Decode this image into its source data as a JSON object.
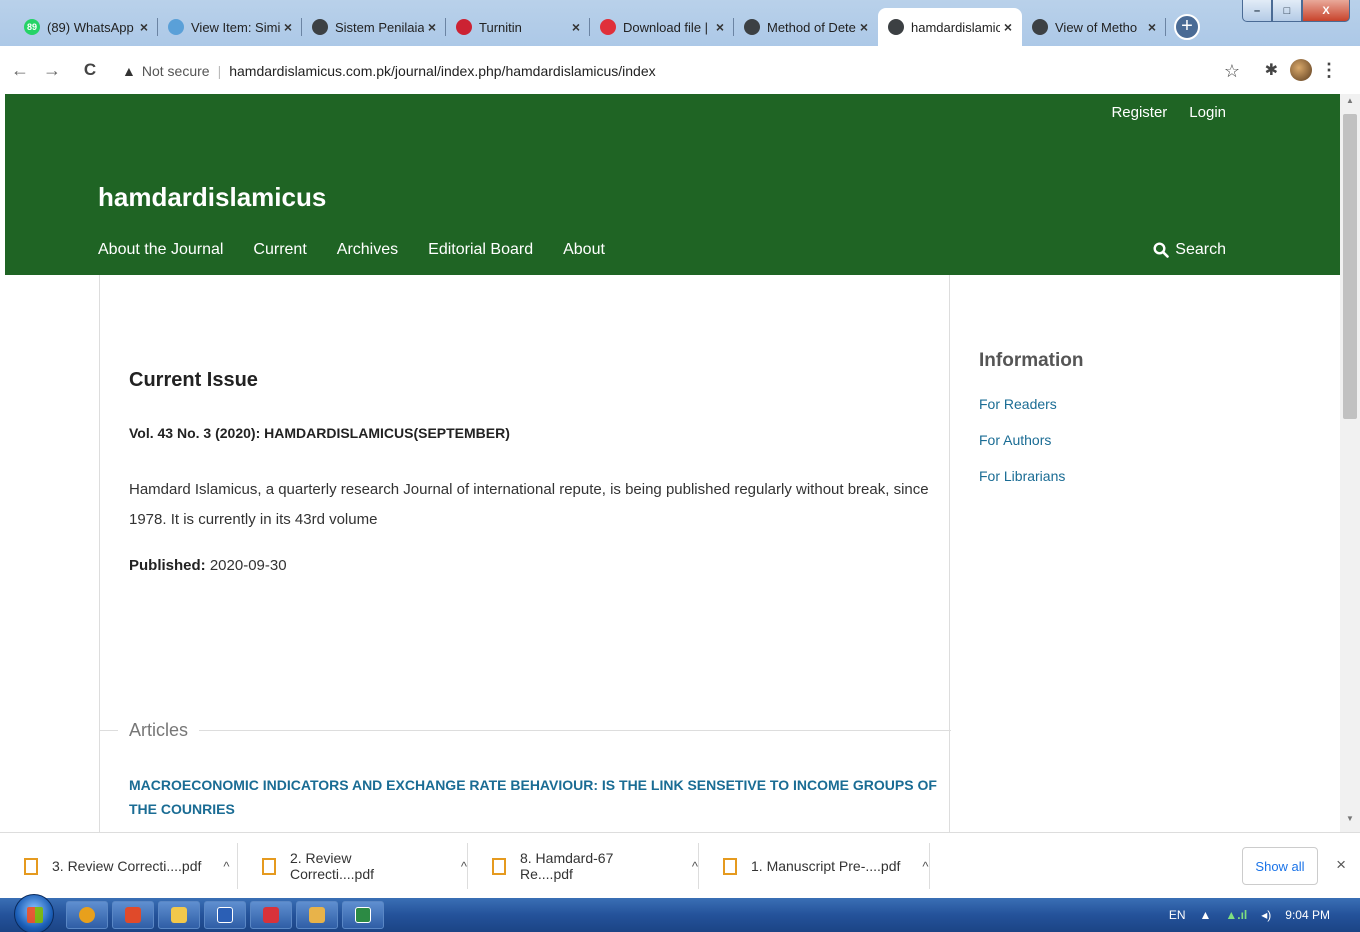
{
  "browser": {
    "tabs": [
      {
        "title": "(89) WhatsApp",
        "icon": "whatsapp-icon",
        "fav": "#25d366",
        "favtext": "89",
        "active": false
      },
      {
        "title": "View Item: Simi",
        "icon": "repository-icon",
        "fav": "#5aa0d8",
        "favtext": "",
        "active": false
      },
      {
        "title": "Sistem Penilaian",
        "icon": "globe-icon",
        "fav": "#3c4043",
        "favtext": "",
        "active": false
      },
      {
        "title": "Turnitin",
        "icon": "turnitin-icon",
        "fav": "#cc2233",
        "favtext": "",
        "active": false
      },
      {
        "title": "Download file |",
        "icon": "heart-icon",
        "fav": "#e0303a",
        "favtext": "",
        "active": false
      },
      {
        "title": "Method of Dete",
        "icon": "globe-icon",
        "fav": "#3c4043",
        "favtext": "",
        "active": false
      },
      {
        "title": "hamdardislamic",
        "icon": "globe-icon",
        "fav": "#3c4043",
        "favtext": "",
        "active": true
      },
      {
        "title": "View of Metho",
        "icon": "globe-icon",
        "fav": "#3c4043",
        "favtext": "",
        "active": false
      }
    ],
    "new_tab": "+",
    "close_glyph": "×",
    "back": "←",
    "forward": "→",
    "reload": "C",
    "security": "Not secure",
    "url": "hamdardislamicus.com.pk/journal/index.php/hamdardislamicus/index",
    "bookmark": "☆",
    "extensions": "✱",
    "menu": "⋮",
    "window_controls": {
      "minimize": "–",
      "maximize": "□",
      "close": "X"
    }
  },
  "site": {
    "colors": {
      "header_bg": "#1f6424",
      "link": "#1a6c94"
    },
    "user_nav": [
      "Register",
      "Login"
    ],
    "name": "hamdardislamicus",
    "primary_nav": [
      "About the Journal",
      "Current",
      "Archives",
      "Editorial Board",
      "About"
    ],
    "search_label": "Search"
  },
  "main": {
    "heading": "Current Issue",
    "volume": "Vol. 43 No. 3 (2020): HAMDARDISLAMICUS(SEPTEMBER)",
    "description": "Hamdard Islamicus, a quarterly research Journal of international repute, is being published regularly without break, since 1978. It is currently in its 43rd volume",
    "published_label": "Published:",
    "published_date": "2020-09-30",
    "articles_label": "Articles",
    "article_title": "MACROECONOMIC INDICATORS AND EXCHANGE RATE BEHAVIOUR: IS THE LINK SENSETIVE TO INCOME GROUPS OF THE COUNRIES"
  },
  "sidebar": {
    "heading": "Information",
    "links": [
      "For Readers",
      "For Authors",
      "For Librarians"
    ]
  },
  "downloads": {
    "items": [
      "3. Review Correcti....pdf",
      "2. Review Correcti....pdf",
      "8. Hamdard-67 Re....pdf",
      "1. Manuscript Pre-....pdf"
    ],
    "show_all": "Show all",
    "close": "×",
    "chevron": "^"
  },
  "taskbar": {
    "language": "EN",
    "tray_arrow": "▲",
    "clock": "9:04 PM",
    "apps": [
      {
        "name": "chrome-app",
        "color": "#e8a01c"
      },
      {
        "name": "acrobat-app",
        "color": "#e04a2a"
      },
      {
        "name": "explorer-app",
        "color": "#f2c84b"
      },
      {
        "name": "word-app",
        "color": "#2b5fb5"
      },
      {
        "name": "pdf-reader-app",
        "color": "#d8323a"
      },
      {
        "name": "notes-app",
        "color": "#e8b34a"
      },
      {
        "name": "excel-app",
        "color": "#2c8a44"
      }
    ]
  }
}
